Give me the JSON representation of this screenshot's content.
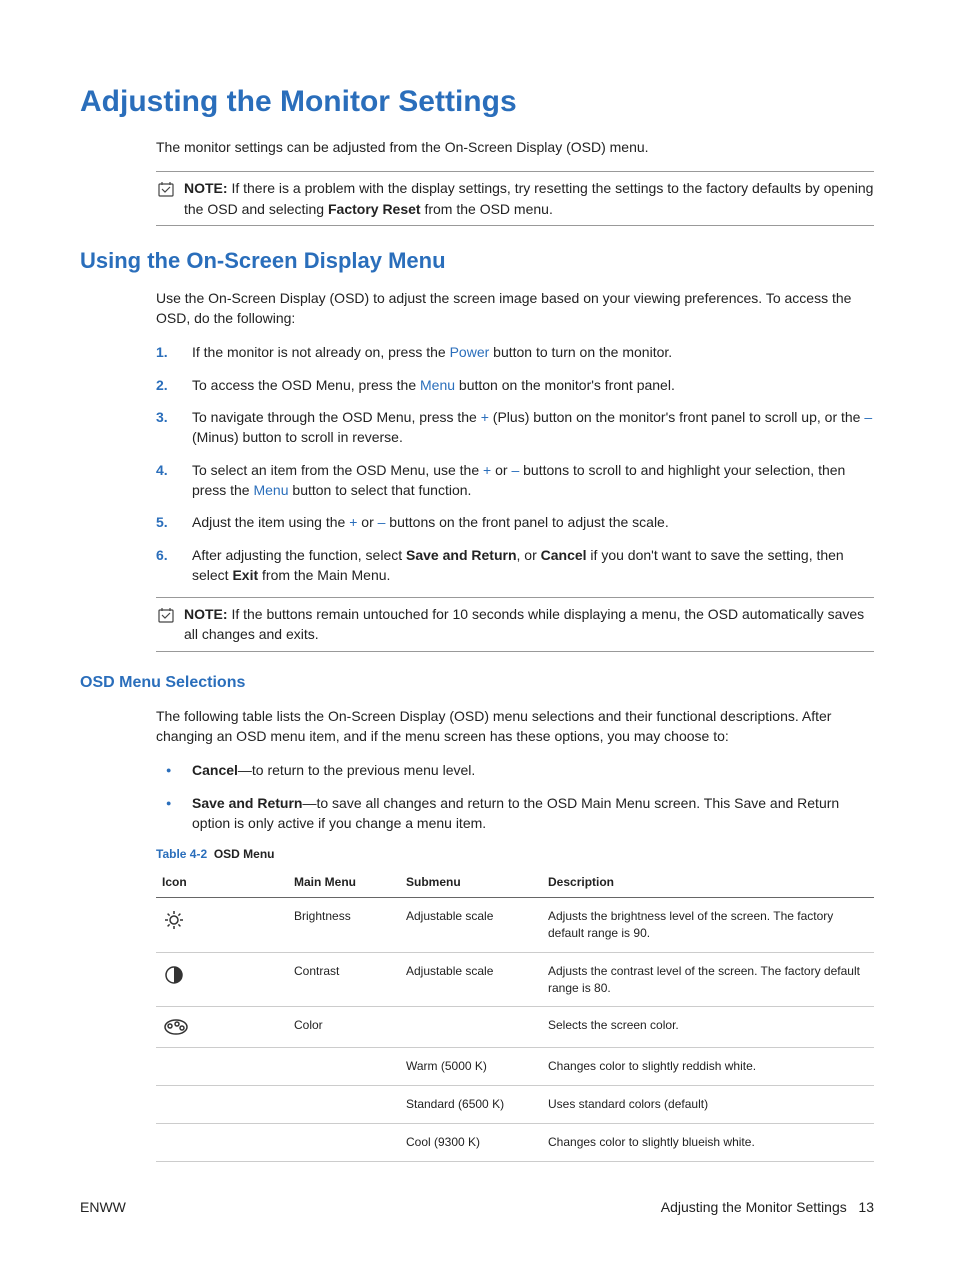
{
  "title": "Adjusting the Monitor Settings",
  "intro": "The monitor settings can be adjusted from the On-Screen Display (OSD) menu.",
  "note1": {
    "label": "NOTE:",
    "before": "If there is a problem with the display settings, try resetting the settings to the factory defaults by opening the OSD and selecting ",
    "bold": "Factory Reset",
    "after": " from the OSD menu."
  },
  "section_osd": {
    "heading": "Using the On-Screen Display Menu",
    "intro": "Use the On-Screen Display (OSD) to adjust the screen image based on your viewing preferences. To access the OSD, do the following:",
    "steps": [
      {
        "num": "1.",
        "pre": "If the monitor is not already on, press the ",
        "link": "Power",
        "post": " button to turn on the monitor."
      },
      {
        "num": "2.",
        "pre": "To access the OSD Menu, press the ",
        "link": "Menu",
        "post": " button on the monitor's front panel."
      },
      {
        "num": "3.",
        "pre": "To navigate through the OSD Menu, press the ",
        "link": "+",
        "mid1": " (Plus) button on the monitor's front panel to scroll up, or the ",
        "link2": "–",
        "post": " (Minus) button to scroll in reverse."
      },
      {
        "num": "4.",
        "pre": "To select an item from the OSD Menu, use the ",
        "link": "+",
        "mid1": " or ",
        "link2": "–",
        "mid2": " buttons to scroll to and highlight your selection, then press the ",
        "link3": "Menu",
        "post": " button to select that function."
      },
      {
        "num": "5.",
        "pre": "Adjust the item using the ",
        "link": "+",
        "mid1": " or ",
        "link2": "–",
        "post": " buttons on the front panel to adjust the scale."
      },
      {
        "num": "6.",
        "pre": "After adjusting the function, select ",
        "bold1": "Save and Return",
        "mid1": ", or ",
        "bold2": "Cancel",
        "mid2": " if you don't want to save the setting, then select ",
        "bold3": "Exit",
        "post": " from the Main Menu."
      }
    ],
    "note2": {
      "label": "NOTE:",
      "text": "If the buttons remain untouched for 10 seconds while displaying a menu, the OSD automatically saves all changes and exits."
    }
  },
  "section_selections": {
    "heading": "OSD Menu Selections",
    "intro": "The following table lists the On-Screen Display (OSD) menu selections and their functional descriptions. After changing an OSD menu item, and if the menu screen has these options, you may choose to:",
    "bullets": [
      {
        "bold": "Cancel",
        "rest": "—to return to the previous menu level."
      },
      {
        "bold": "Save and Return",
        "rest": "—to save all changes and return to the OSD Main Menu screen. This Save and Return option is only active if you change a menu item."
      }
    ]
  },
  "table": {
    "caption_prefix": "Table 4-2",
    "caption_title": "OSD Menu",
    "headers": {
      "icon": "Icon",
      "main": "Main Menu",
      "sub": "Submenu",
      "desc": "Description"
    },
    "rows": [
      {
        "icon": "brightness",
        "main": "Brightness",
        "sub": "Adjustable scale",
        "desc": "Adjusts the brightness level of the screen. The factory default range is 90."
      },
      {
        "icon": "contrast",
        "main": "Contrast",
        "sub": "Adjustable scale",
        "desc": "Adjusts the contrast level of the screen. The factory default range is 80."
      },
      {
        "icon": "color",
        "main": "Color",
        "sub": "",
        "desc": "Selects the screen color."
      },
      {
        "icon": "",
        "main": "",
        "sub": "Warm (5000 K)",
        "desc": "Changes color to slightly reddish white."
      },
      {
        "icon": "",
        "main": "",
        "sub": "Standard (6500 K)",
        "desc": "Uses standard colors (default)"
      },
      {
        "icon": "",
        "main": "",
        "sub": "Cool (9300 K)",
        "desc": "Changes color to slightly blueish white."
      }
    ]
  },
  "footer": {
    "left": "ENWW",
    "right_label": "Adjusting the Monitor Settings",
    "page": "13"
  }
}
